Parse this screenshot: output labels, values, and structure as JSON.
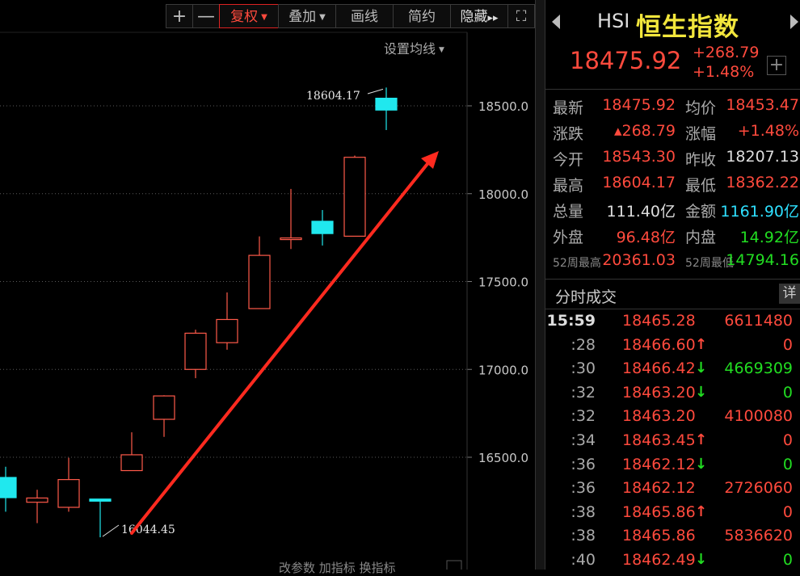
{
  "toolbar": {
    "zoom_in": "+",
    "zoom_out": "—",
    "adjust_label": "复权",
    "overlay_label": "叠加",
    "draw_label": "画线",
    "simple_label": "简约",
    "hide_label": "隐藏",
    "hide_arrows": "▸▸",
    "fullscreen": "⛶"
  },
  "ma_setting": "设置均线",
  "bottom_tools": "改参数  加指标  换指标",
  "chart_data": {
    "type": "candlestick",
    "ylim": [
      16000,
      18800
    ],
    "y_ticks": [
      "18500.0",
      "18000.0",
      "17500.0",
      "17000.0",
      "16500.0"
    ],
    "y_tick_values": [
      18500,
      18000,
      17500,
      17000,
      16500
    ],
    "high_marker": "18604.17",
    "low_marker": "16044.45",
    "colors": {
      "up": "#ff5a4a",
      "down": "#20e8ee",
      "grid": "#5a5a5a",
      "axis": "#c8c8c8",
      "arrow": "#ff2a1f"
    },
    "candles": [
      {
        "o": 16385,
        "h": 16446,
        "l": 16190,
        "c": 16270
      },
      {
        "o": 16244,
        "h": 16315,
        "l": 16125,
        "c": 16268
      },
      {
        "o": 16215,
        "h": 16497,
        "l": 16190,
        "c": 16373
      },
      {
        "o": 16262,
        "h": 16262,
        "l": 16044.45,
        "c": 16250
      },
      {
        "o": 16424,
        "h": 16642,
        "l": 16424,
        "c": 16514
      },
      {
        "o": 16716,
        "h": 16853,
        "l": 16616,
        "c": 16849
      },
      {
        "o": 17000,
        "h": 17226,
        "l": 16950,
        "c": 17206
      },
      {
        "o": 17152,
        "h": 17438,
        "l": 17112,
        "c": 17284
      },
      {
        "o": 17346,
        "h": 17757,
        "l": 17346,
        "c": 17649
      },
      {
        "o": 17741,
        "h": 18027,
        "l": 17685,
        "c": 17748
      },
      {
        "o": 17843,
        "h": 17907,
        "l": 17705,
        "c": 17773
      },
      {
        "o": 17758,
        "h": 18217,
        "l": 17758,
        "c": 18207.13
      },
      {
        "o": 18543.3,
        "h": 18604.17,
        "l": 18362.22,
        "c": 18475.92
      }
    ]
  },
  "symbol": {
    "code": "HSI",
    "name": "恒生指数"
  },
  "price": {
    "last": "18475.92",
    "chg": "+268.79",
    "pct": "+1.48%",
    "add": "+"
  },
  "quote": {
    "rows": [
      {
        "l1": "最新",
        "v1": "18475.92",
        "l2": "均价",
        "v2": "18453.47"
      },
      {
        "l1": "涨跌",
        "v1": "▴268.79",
        "l2": "涨幅",
        "v2": "+1.48%"
      },
      {
        "l1": "今开",
        "v1": "18543.30",
        "l2": "昨收",
        "v2": "18207.13"
      },
      {
        "l1": "最高",
        "v1": "18604.17",
        "l2": "最低",
        "v2": "18362.22"
      },
      {
        "l1": "总量",
        "v1": "111.40亿",
        "l2": "金额",
        "v2": "1161.90亿"
      },
      {
        "l1": "外盘",
        "v1": "96.48亿",
        "l2": "内盘",
        "v2": "14.92亿"
      },
      {
        "l1": "52周最高",
        "v1": "20361.03",
        "l2": "52周最低",
        "v2": "14794.16"
      }
    ]
  },
  "ticks": {
    "title": "分时成交",
    "detail": "详",
    "rows": [
      {
        "time": "15:59",
        "price": "18465.28",
        "arrow": "",
        "vol": "6611480",
        "vc": "red"
      },
      {
        "time": ":28",
        "price": "18466.60",
        "arrow": "🠕",
        "vol": "0",
        "vc": "red"
      },
      {
        "time": ":30",
        "price": "18466.42",
        "arrow": "🠗",
        "vol": "4669309",
        "vc": "green"
      },
      {
        "time": ":32",
        "price": "18463.20",
        "arrow": "🠗",
        "vol": "0",
        "vc": "green"
      },
      {
        "time": ":32",
        "price": "18463.20",
        "arrow": "",
        "vol": "4100080",
        "vc": "red"
      },
      {
        "time": ":34",
        "price": "18463.45",
        "arrow": "🠕",
        "vol": "0",
        "vc": "red"
      },
      {
        "time": ":36",
        "price": "18462.12",
        "arrow": "🠗",
        "vol": "0",
        "vc": "green"
      },
      {
        "time": ":36",
        "price": "18462.12",
        "arrow": "",
        "vol": "2726060",
        "vc": "red"
      },
      {
        "time": ":38",
        "price": "18465.86",
        "arrow": "🠕",
        "vol": "0",
        "vc": "red"
      },
      {
        "time": ":38",
        "price": "18465.86",
        "arrow": "",
        "vol": "5836620",
        "vc": "red"
      },
      {
        "time": ":40",
        "price": "18462.49",
        "arrow": "🠗",
        "vol": "0",
        "vc": "green"
      }
    ]
  }
}
